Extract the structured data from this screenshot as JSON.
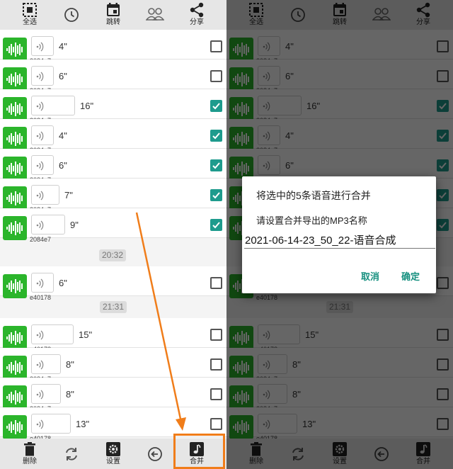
{
  "toolbar": {
    "select_all": "全选",
    "jump": "跳转",
    "share": "分享"
  },
  "bottombar": {
    "delete": "删除",
    "settings": "设置",
    "merge": "合并"
  },
  "rows": [
    {
      "duration": "4\"",
      "uid": "2084e7",
      "checked": false
    },
    {
      "duration": "6\"",
      "uid": "2084e7",
      "checked": false
    },
    {
      "duration": "16\"",
      "uid": "2084e7",
      "checked": true
    },
    {
      "duration": "4\"",
      "uid": "2084e7",
      "checked": true
    },
    {
      "duration": "6\"",
      "uid": "2084e7",
      "checked": true
    },
    {
      "duration": "7\"",
      "uid": "2084e7",
      "checked": true
    },
    {
      "duration": "9\"",
      "uid": "2084e7",
      "checked": true
    },
    {
      "duration": "6\"",
      "uid": "e40178",
      "checked": false
    },
    {
      "duration": "15\"",
      "uid": "e40178",
      "checked": false
    },
    {
      "duration": "8\"",
      "uid": "2084e7",
      "checked": false
    },
    {
      "duration": "8\"",
      "uid": "2084e7",
      "checked": false
    },
    {
      "duration": "13\"",
      "uid": "e40178",
      "checked": false
    }
  ],
  "time_markers": [
    "20:32",
    "21:31"
  ],
  "dialog": {
    "message": "将选中的5条语音进行合并",
    "prompt": "请设置合并导出的MP3名称",
    "input_value": "2021-06-14-23_50_22-语音合成",
    "cancel": "取消",
    "confirm": "确定"
  },
  "colors": {
    "avatar_green": "#2bb52b",
    "checkbox_teal": "#1e9b8d",
    "annotation_orange": "#f07d1a"
  }
}
